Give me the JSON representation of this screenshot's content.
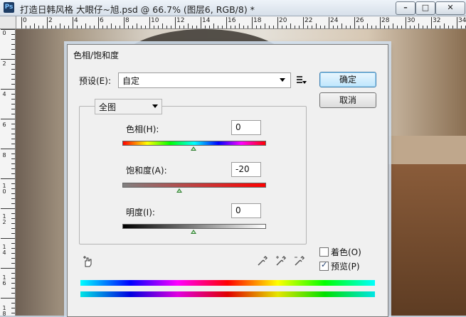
{
  "window": {
    "title": "打造日韩风格 大眼仔~旭.psd @ 66.7% (图层6, RGB/8) *",
    "app_icon": "Ps"
  },
  "ruler_top_labels": [
    "0",
    "2",
    "4",
    "6",
    "8",
    "10",
    "12",
    "14",
    "16",
    "18",
    "20",
    "22",
    "24",
    "26",
    "28",
    "30",
    "32",
    "34"
  ],
  "ruler_left_labels": [
    "0",
    "2",
    "4",
    "6",
    "8",
    "10",
    "12",
    "14",
    "16",
    "18"
  ],
  "dialog": {
    "title": "色相/饱和度",
    "preset_label": "预设(E):",
    "preset_value": "自定",
    "ok_label": "确定",
    "cancel_label": "取消",
    "range_value": "全图",
    "hue": {
      "label": "色相(H):",
      "value": "0"
    },
    "saturation": {
      "label": "饱和度(A):",
      "value": "-20"
    },
    "lightness": {
      "label": "明度(I):",
      "value": "0"
    },
    "colorize_label": "着色(O)",
    "preview_label": "预览(P)",
    "colorize_checked": false,
    "preview_checked": true
  },
  "colors": {
    "thumb": "#2f7d2f",
    "primary_border": "#3c7fb1"
  }
}
